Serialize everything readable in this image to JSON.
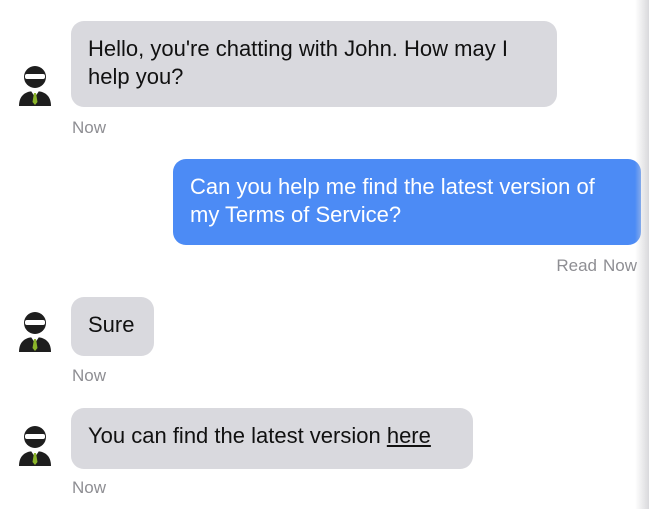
{
  "agent": {
    "name": "John",
    "avatar_icon": "agent-avatar-icon"
  },
  "messages": [
    {
      "sender": "agent",
      "text": "Hello, you're chatting with John. How may I help you?",
      "time": "Now"
    },
    {
      "sender": "user",
      "text": "Can you help me find the latest version of my Terms of Service?",
      "status": "Read",
      "time": "Now"
    },
    {
      "sender": "agent",
      "text": "Sure",
      "time": "Now"
    },
    {
      "sender": "agent",
      "text_before": "You can find the latest version ",
      "link_text": "here",
      "time": "Now"
    }
  ],
  "colors": {
    "incoming_bubble": "#d9d9de",
    "outgoing_bubble": "#4c8bf5",
    "meta_text": "#8e8e93"
  }
}
